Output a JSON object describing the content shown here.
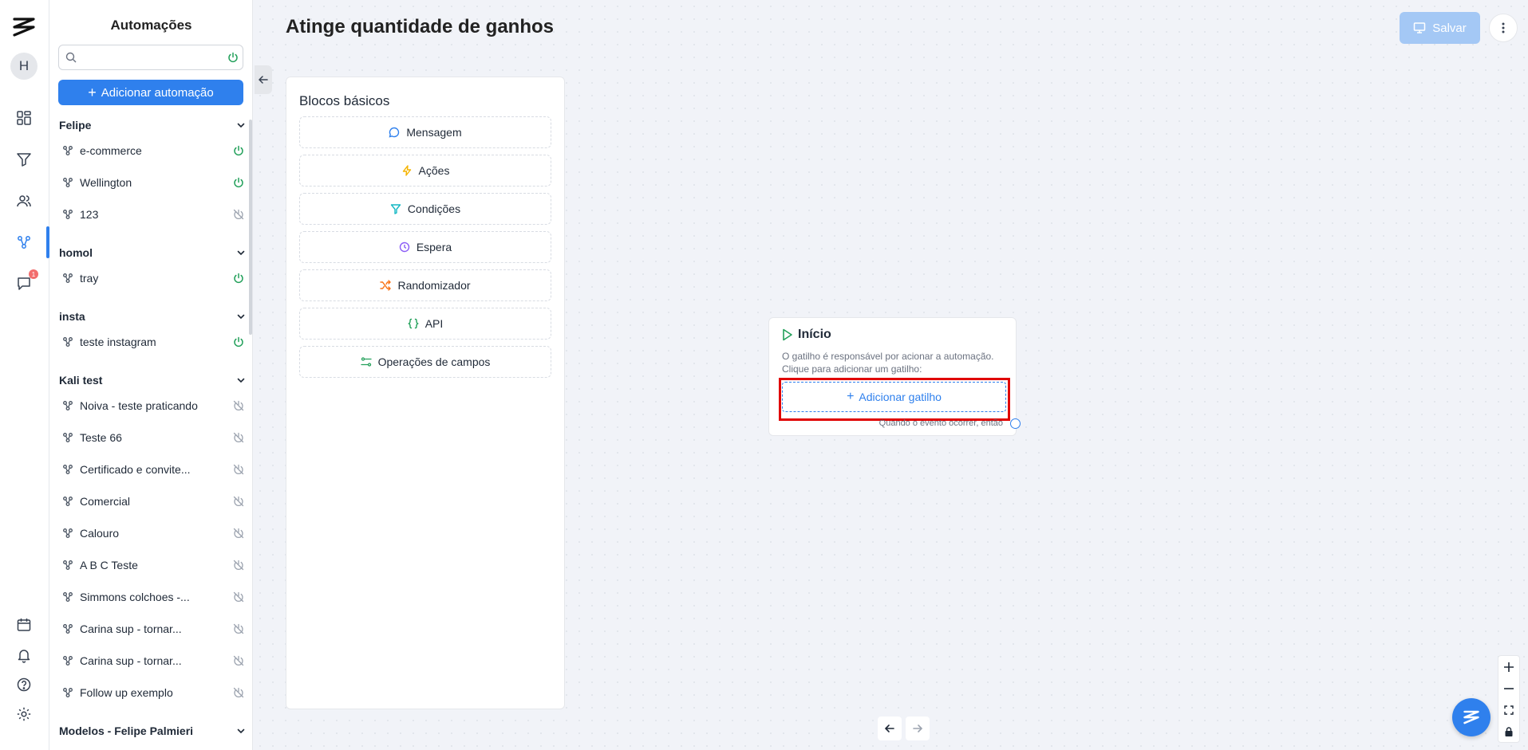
{
  "rail": {
    "avatar_initial": "H",
    "notification_count": "1",
    "icons": [
      "logo-icon",
      "dashboard-icon",
      "funnel-icon",
      "users-icon",
      "automation-icon",
      "chat-icon",
      "calendar-icon",
      "bell-icon",
      "help-icon",
      "settings-icon"
    ]
  },
  "sidebar": {
    "title": "Automações",
    "search": {
      "value": "",
      "placeholder": ""
    },
    "add_label": "Adicionar automação",
    "groups": [
      {
        "name": "Felipe",
        "items": [
          {
            "label": "e-commerce",
            "active": true
          },
          {
            "label": "Wellington",
            "active": true
          },
          {
            "label": "123",
            "active": false
          }
        ]
      },
      {
        "name": "homol",
        "items": [
          {
            "label": "tray",
            "active": true
          }
        ]
      },
      {
        "name": "insta",
        "items": [
          {
            "label": "teste instagram",
            "active": true
          }
        ]
      },
      {
        "name": "Kali test",
        "items": [
          {
            "label": "Noiva - teste praticando",
            "active": false
          },
          {
            "label": "Teste 66",
            "active": false
          },
          {
            "label": "Certificado e convite...",
            "active": false
          },
          {
            "label": "Comercial",
            "active": false
          },
          {
            "label": "Calouro",
            "active": false
          },
          {
            "label": "A B C Teste",
            "active": false
          },
          {
            "label": "Simmons colchoes -...",
            "active": false
          },
          {
            "label": "Carina sup - tornar...",
            "active": false
          },
          {
            "label": "Carina sup - tornar...",
            "active": false
          },
          {
            "label": "Follow up exemplo",
            "active": false
          }
        ]
      },
      {
        "name": "Modelos - Felipe Palmieri",
        "items": []
      }
    ]
  },
  "header": {
    "title": "Atinge quantidade de ganhos",
    "save_label": "Salvar"
  },
  "blocks": {
    "title": "Blocos básicos",
    "items": [
      {
        "label": "Mensagem",
        "icon": "message-icon",
        "color": "#2f80ed"
      },
      {
        "label": "Ações",
        "icon": "lightning-icon",
        "color": "#f5b400"
      },
      {
        "label": "Condições",
        "icon": "filter-icon",
        "color": "#14b8c4"
      },
      {
        "label": "Espera",
        "icon": "clock-icon",
        "color": "#8b5cf6"
      },
      {
        "label": "Randomizador",
        "icon": "shuffle-icon",
        "color": "#f97316"
      },
      {
        "label": "API",
        "icon": "braces-icon",
        "color": "#22a05a"
      },
      {
        "label": "Operações de campos",
        "icon": "fields-icon",
        "color": "#22a05a"
      }
    ]
  },
  "start_node": {
    "title": "Início",
    "description": "O gatilho é responsável por acionar a automação. Clique para adicionar um gatilho:",
    "button_label": "Adicionar gatilho",
    "footer": "Quando o evento ocorrer, então"
  },
  "colors": {
    "accent": "#2f80ed",
    "active_power": "#22a05a",
    "inactive_power": "#9ca3af",
    "highlight": "#e00000"
  }
}
